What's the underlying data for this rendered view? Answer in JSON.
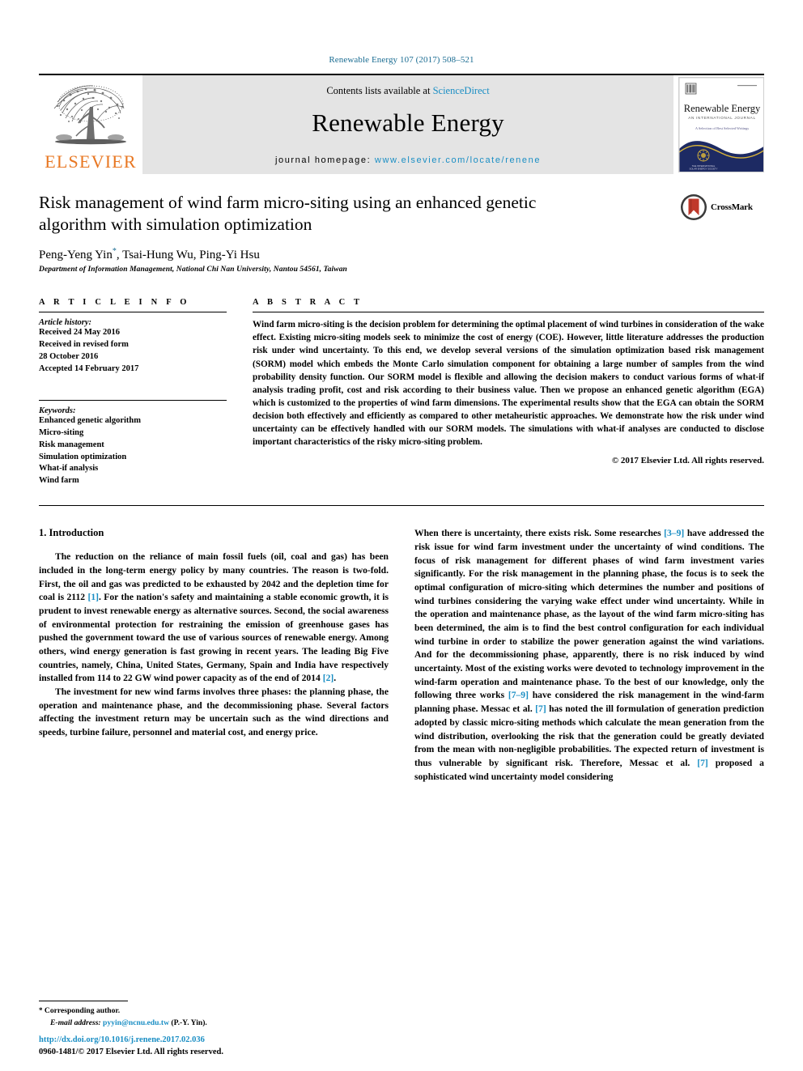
{
  "running_head": "Renewable Energy 107 (2017) 508–521",
  "masthead": {
    "elsevier_wordmark": "ELSEVIER",
    "contents_prefix": "Contents lists available at ",
    "contents_link": "ScienceDirect",
    "journal_title": "Renewable Energy",
    "homepage_prefix": "journal homepage: ",
    "homepage_url": "www.elsevier.com/locate/renene",
    "cover": {
      "title": "Renewable Energy",
      "subtitle": "AN INTERNATIONAL JOURNAL",
      "tagline": "A Selection of Best Selected Writings"
    }
  },
  "article": {
    "title": "Risk management of wind farm micro-siting using an enhanced genetic algorithm with simulation optimization",
    "authors": "Peng-Yeng Yin",
    "authors_rest": ", Tsai-Hung Wu, Ping-Yi Hsu",
    "author_marker": "*",
    "affiliation": "Department of Information Management, National Chi Nan University, Nantou 54561, Taiwan",
    "crossmark_label": "CrossMark"
  },
  "article_info": {
    "heading": "A R T I C L E  I N F O",
    "history_label": "Article history:",
    "history": [
      "Received 24 May 2016",
      "Received in revised form",
      "28 October 2016",
      "Accepted 14 February 2017"
    ],
    "keywords_label": "Keywords:",
    "keywords": [
      "Enhanced genetic algorithm",
      "Micro-siting",
      "Risk management",
      "Simulation optimization",
      "What-if analysis",
      "Wind farm"
    ]
  },
  "abstract": {
    "heading": "A B S T R A C T",
    "text": "Wind farm micro-siting is the decision problem for determining the optimal placement of wind turbines in consideration of the wake effect. Existing micro-siting models seek to minimize the cost of energy (COE). However, little literature addresses the production risk under wind uncertainty. To this end, we develop several versions of the simulation optimization based risk management (SORM) model which embeds the Monte Carlo simulation component for obtaining a large number of samples from the wind probability density function. Our SORM model is flexible and allowing the decision makers to conduct various forms of what-if analysis trading profit, cost and risk according to their business value. Then we propose an enhanced genetic algorithm (EGA) which is customized to the properties of wind farm dimensions. The experimental results show that the EGA can obtain the SORM decision both effectively and efficiently as compared to other metaheuristic approaches. We demonstrate how the risk under wind uncertainty can be effectively handled with our SORM models. The simulations with what-if analyses are conducted to disclose important characteristics of the risky micro-siting problem.",
    "copyright": "© 2017 Elsevier Ltd. All rights reserved."
  },
  "main": {
    "section_number_title": "1. Introduction",
    "left_paragraph_1_a": "The reduction on the reliance of main fossil fuels (oil, coal and gas) has been included in the long-term energy policy by many countries. The reason is two-fold. First, the oil and gas was predicted to be exhausted by 2042 and the depletion time for coal is 2112 ",
    "left_ref_1": "[1]",
    "left_paragraph_1_b": ". For the nation's safety and maintaining a stable economic growth, it is prudent to invest renewable energy as alternative sources. Second, the social awareness of environmental protection for restraining the emission of greenhouse gases has pushed the government toward the use of various sources of renewable energy. Among others, wind energy generation is fast growing in recent years. The leading Big Five countries, namely, China, United States, Germany, Spain and India have respectively installed from 114 to 22 GW wind power capacity as of the end of 2014 ",
    "left_ref_2": "[2]",
    "left_paragraph_1_c": ".",
    "left_paragraph_2": "The investment for new wind farms involves three phases: the planning phase, the operation and maintenance phase, and the decommissioning phase. Several factors affecting the investment return may be uncertain such as the wind directions and speeds, turbine failure, personnel and material cost, and energy price.",
    "right_paragraph_a": "When there is uncertainty, there exists risk. Some researches ",
    "right_ref_1": "[3–9]",
    "right_paragraph_b": " have addressed the risk issue for wind farm investment under the uncertainty of wind conditions. The focus of risk management for different phases of wind farm investment varies significantly. For the risk management in the planning phase, the focus is to seek the optimal configuration of micro-siting which determines the number and positions of wind turbines considering the varying wake effect under wind uncertainty. While in the operation and maintenance phase, as the layout of the wind farm micro-siting has been determined, the aim is to find the best control configuration for each individual wind turbine in order to stabilize the power generation against the wind variations. And for the decommissioning phase, apparently, there is no risk induced by wind uncertainty. Most of the existing works were devoted to technology improvement in the wind-farm operation and maintenance phase. To the best of our knowledge, only the following three works ",
    "right_ref_2": "[7–9]",
    "right_paragraph_c": " have considered the risk management in the wind-farm planning phase. Messac et al. ",
    "right_ref_3": "[7]",
    "right_paragraph_d": " has noted the ill formulation of generation prediction adopted by classic micro-siting methods which calculate the mean generation from the wind distribution, overlooking the risk that the generation could be greatly deviated from the mean with non-negligible probabilities. The expected return of investment is thus vulnerable by significant risk. Therefore, Messac et al. ",
    "right_ref_4": "[7]",
    "right_paragraph_e": " proposed a sophisticated wind uncertainty model considering"
  },
  "footnote": {
    "star": "*",
    "corresponding": " Corresponding author.",
    "email_label": "E-mail address: ",
    "email": "pyyin@ncnu.edu.tw",
    "email_suffix": " (P.-Y. Yin)."
  },
  "footer": {
    "doi": "http://dx.doi.org/10.1016/j.renene.2017.02.036",
    "issn": "0960-1481/© 2017 Elsevier Ltd. All rights reserved."
  },
  "colors": {
    "link_blue": "#1a8ec4",
    "head_blue": "#1a6c92",
    "elsevier_orange": "#E87722",
    "band_gray": "#e4e4e4",
    "cover_navy": "#1d2a63",
    "crossmark_red": "#c0392b"
  }
}
